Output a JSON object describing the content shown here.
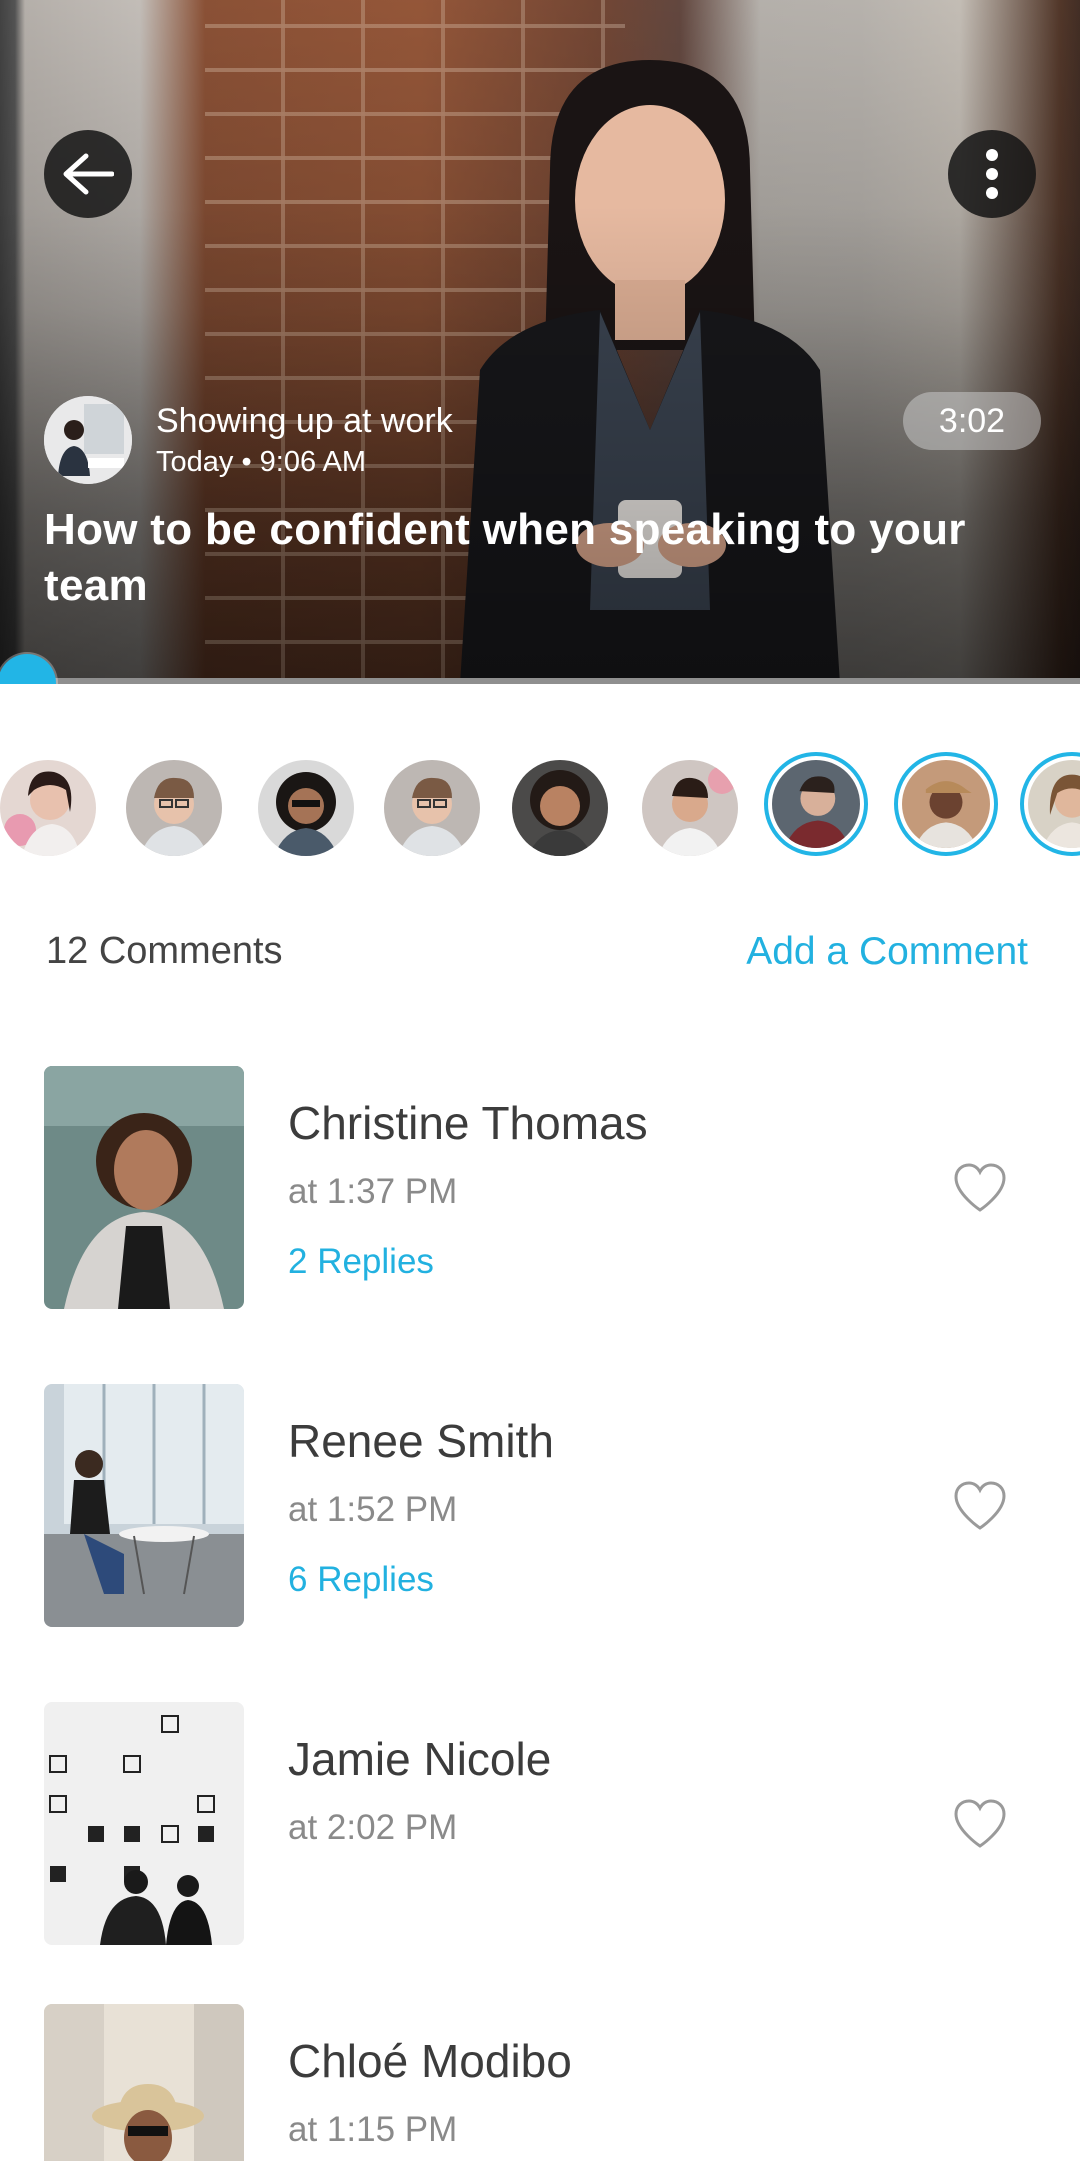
{
  "video": {
    "channel_name": "Showing up at work",
    "posted": "Today • 9:06 AM",
    "duration": "3:02",
    "title": "How to be confident when speaking to your team",
    "progress": 0.0
  },
  "icons": {
    "back": "arrow-left-icon",
    "menu": "more-vertical-icon",
    "like": "heart-outline-icon"
  },
  "colors": {
    "accent": "#22b5e6",
    "link": "#22b1e0"
  },
  "comments_header": {
    "count_label": "12 Comments",
    "add_label": "Add a Comment"
  },
  "comments": [
    {
      "name": "Christine Thomas",
      "time": "at 1:37 PM",
      "replies": "2 Replies"
    },
    {
      "name": "Renee Smith",
      "time": "at 1:52 PM",
      "replies": "6 Replies"
    },
    {
      "name": "Jamie Nicole",
      "time": "at 2:02 PM",
      "replies": ""
    },
    {
      "name": "Chloé Modibo",
      "time": "at 1:15 PM",
      "replies": ""
    }
  ]
}
